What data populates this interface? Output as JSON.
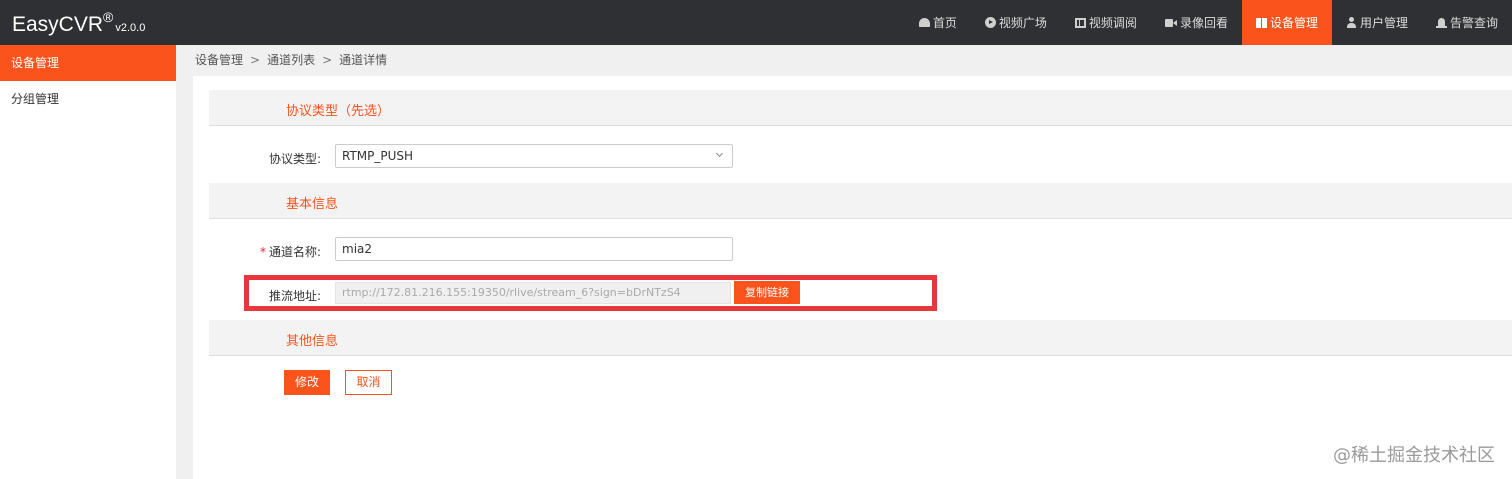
{
  "app": {
    "name": "EasyCVR",
    "reg_mark": "®",
    "version": "v2.0.0"
  },
  "nav": {
    "items": [
      {
        "label": "首页",
        "icon": "home-icon",
        "active": false
      },
      {
        "label": "视频广场",
        "icon": "play-circle-icon",
        "active": false
      },
      {
        "label": "视频调阅",
        "icon": "grid-view-icon",
        "active": false
      },
      {
        "label": "录像回看",
        "icon": "video-camera-icon",
        "active": false
      },
      {
        "label": "设备管理",
        "icon": "book-icon",
        "active": true
      },
      {
        "label": "用户管理",
        "icon": "user-icon",
        "active": false
      },
      {
        "label": "告警查询",
        "icon": "alarm-icon",
        "active": false
      }
    ]
  },
  "sidebar": {
    "items": [
      {
        "label": "设备管理",
        "active": true
      },
      {
        "label": "分组管理",
        "active": false
      }
    ]
  },
  "breadcrumb": {
    "items": [
      "设备管理",
      "通道列表",
      "通道详情"
    ],
    "separator": ">"
  },
  "sections": {
    "protocol": {
      "title": "协议类型（先选）",
      "label": "协议类型:",
      "value": "RTMP_PUSH"
    },
    "basic": {
      "title": "基本信息",
      "name_label": "通道名称:",
      "name_required_mark": "*",
      "name_value": "mia2",
      "push_label": "推流地址:",
      "push_value": "rtmp://172.81.216.155:19350/rlive/stream_6?sign=bDrNTzS4",
      "copy_label": "复制链接"
    },
    "other": {
      "title": "其他信息"
    }
  },
  "actions": {
    "modify_label": "修改",
    "cancel_label": "取消"
  },
  "watermark": "@稀土掘金技术社区",
  "colors": {
    "accent": "#fa541c",
    "topbar": "#2e3033",
    "highlight": "#e8363d"
  }
}
